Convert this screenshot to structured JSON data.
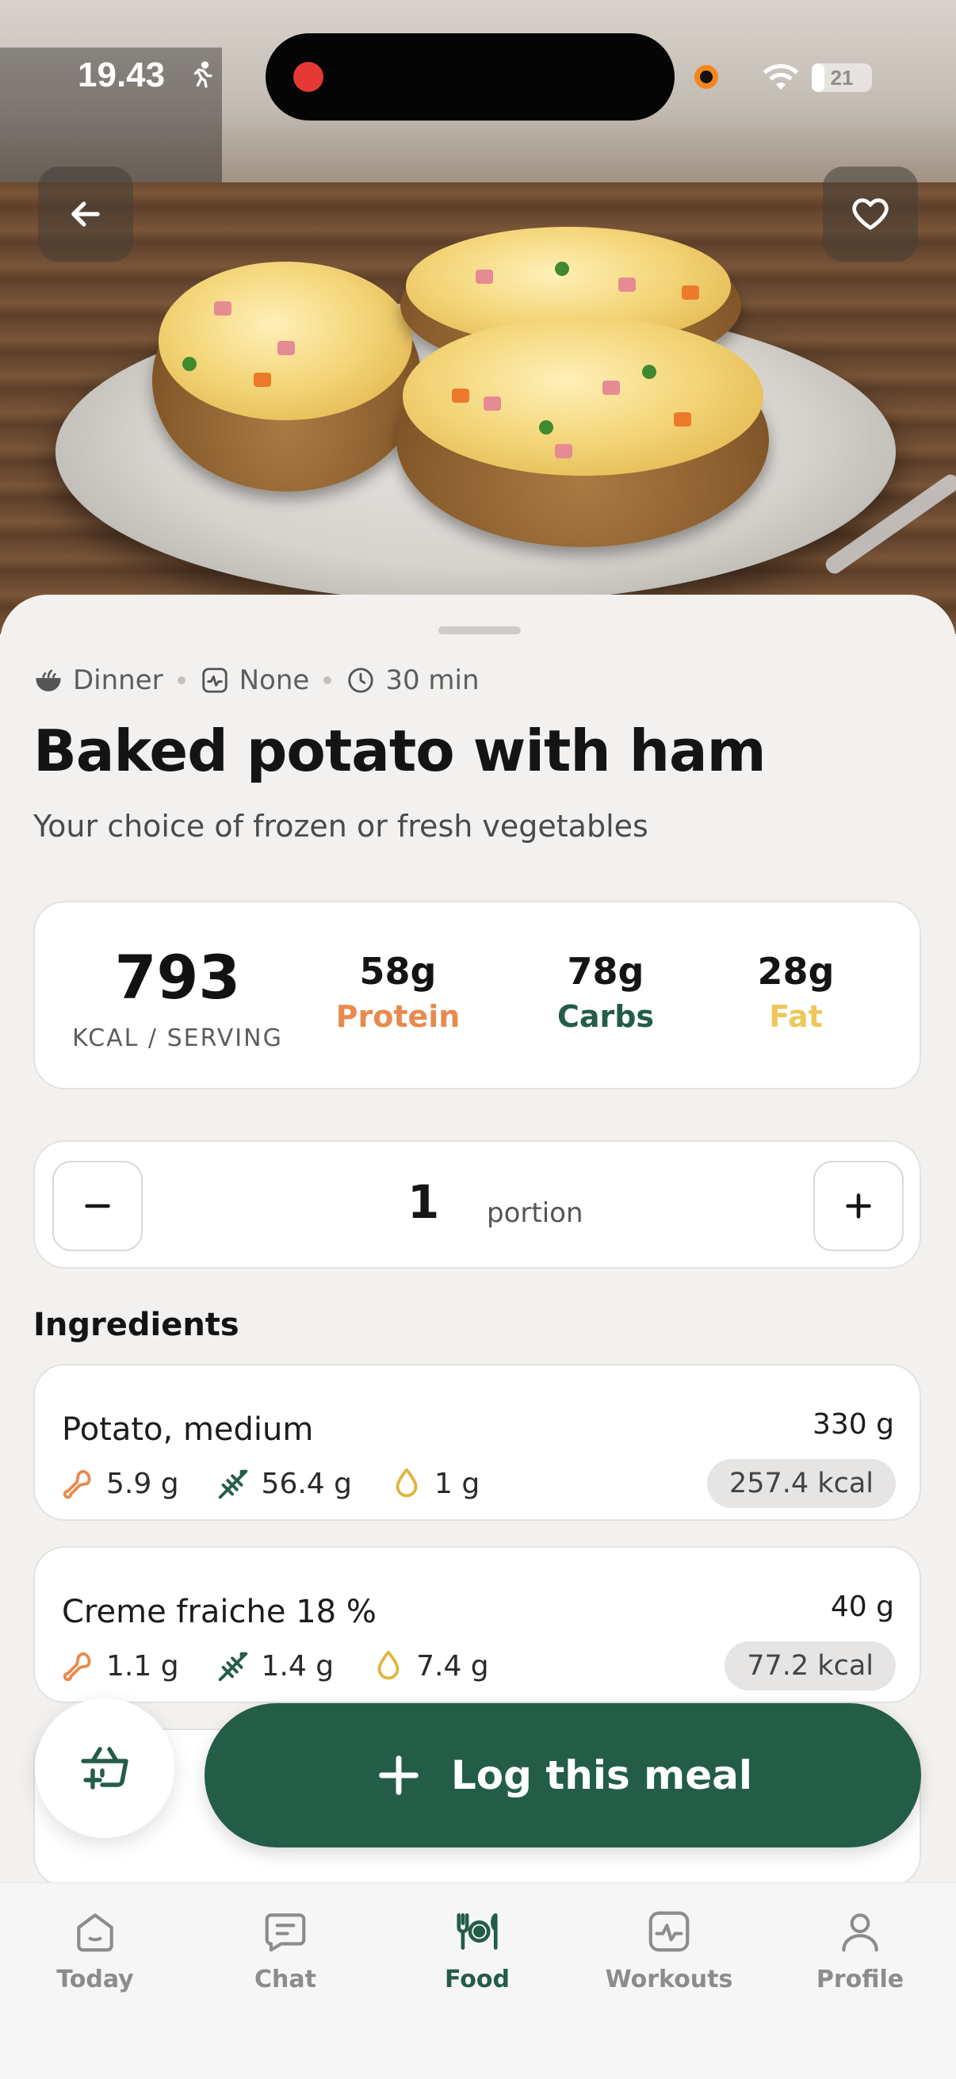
{
  "status_bar": {
    "time": "19.43",
    "battery": "21",
    "battery_level": 0.21
  },
  "recipe": {
    "meal_type": "Dinner",
    "diet": "None",
    "duration": "30 min",
    "title": "Baked potato with ham",
    "subtitle": "Your choice of frozen or fresh vegetables"
  },
  "nutrition": {
    "kcal": "793",
    "kcal_label": "KCAL / SERVING",
    "protein": {
      "value": "58g",
      "label": "Protein",
      "color": "#e88a4e"
    },
    "carbs": {
      "value": "78g",
      "label": "Carbs",
      "color": "#245d47"
    },
    "fat": {
      "value": "28g",
      "label": "Fat",
      "color": "#ecc75b"
    }
  },
  "portion": {
    "count": "1",
    "label": "portion"
  },
  "ingredients_title": "Ingredients",
  "ingredients": [
    {
      "name": "Potato, medium",
      "weight": "330 g",
      "protein": "5.9 g",
      "carbs": "56.4 g",
      "fat": "1 g",
      "kcal": "257.4 kcal"
    },
    {
      "name": "Creme fraiche 18 %",
      "weight": "40 g",
      "protein": "1.1 g",
      "carbs": "1.4 g",
      "fat": "7.4 g",
      "kcal": "77.2 kcal"
    }
  ],
  "actions": {
    "log_meal": "Log this meal"
  },
  "tabs": [
    {
      "label": "Today",
      "icon": "home-icon"
    },
    {
      "label": "Chat",
      "icon": "chat-icon"
    },
    {
      "label": "Food",
      "icon": "food-icon"
    },
    {
      "label": "Workouts",
      "icon": "workouts-icon"
    },
    {
      "label": "Profile",
      "icon": "profile-icon"
    }
  ],
  "active_tab": "Food",
  "colors": {
    "accent": "#245d47",
    "protein": "#e88a4e",
    "fat": "#ecc75b"
  }
}
